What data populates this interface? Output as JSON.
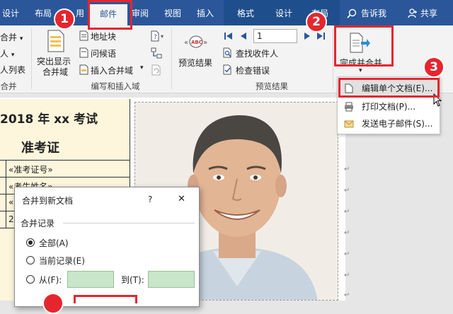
{
  "tabs": {
    "design1": "设计",
    "layout": "布局",
    "references_partial": "用",
    "mailings": "邮件",
    "review_partial": "审阅",
    "view": "视图",
    "insert": "插入",
    "format": "格式",
    "design2": "设计",
    "layout2_partial": "布局",
    "tell_me": "告诉我",
    "share": "共享"
  },
  "ribbon": {
    "start_merge_partial": "合并",
    "select_recipients_partial": "人",
    "edit_list_partial": "人列表",
    "start_group_partial": "合并",
    "highlight_fields": "突出显示",
    "highlight_fields_2": "合并域",
    "address_block": "地址块",
    "greeting_line": "问候语",
    "insert_merge_field": "插入合并域",
    "write_insert_group": "编写和插入域",
    "preview_results": "预览结果",
    "record_number": "1",
    "find_recipient": "查找收件人",
    "check_errors": "检查错误",
    "preview_group": "预览结果",
    "finish_merge": "完成并合并"
  },
  "dropdown": {
    "edit_individual": "编辑单个文档(E)...",
    "print_documents": "打印文档(P)...",
    "send_email": "发送电子邮件(S)..."
  },
  "document": {
    "title": "2018 年 xx 考试",
    "subtitle": "准考证",
    "field_id": "«准考证号»",
    "field_name": "«考生姓名»",
    "row3_partial": "«",
    "row4_partial": "2"
  },
  "dialog": {
    "title": "合并到新文档",
    "help": "?",
    "close": "✕",
    "group_label": "合并记录",
    "all": "全部(A)",
    "current": "当前记录(E)",
    "from": "从(F):",
    "to": "到(T):"
  },
  "badges": {
    "b1": "1",
    "b2": "2",
    "b3": "3"
  },
  "colors": {
    "tab_bar": "#2b579a",
    "annotation_red": "#e5262f",
    "field_green": "#c8e6c9",
    "table_fill": "#fdf6dc"
  }
}
